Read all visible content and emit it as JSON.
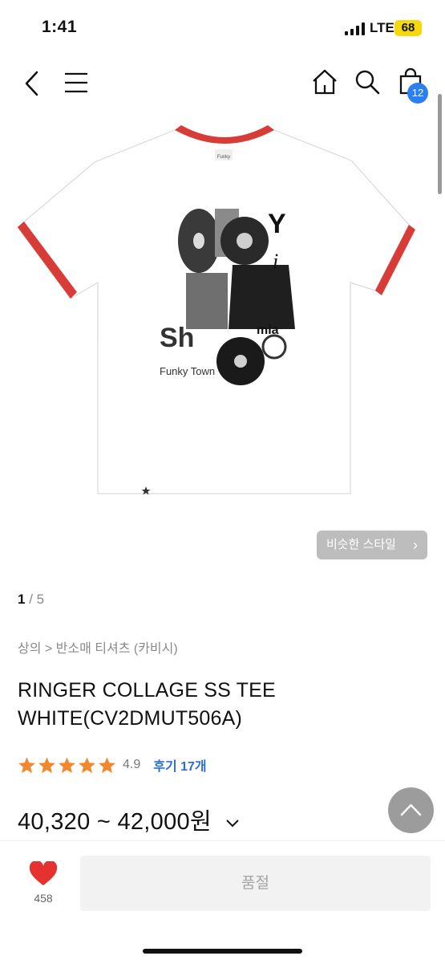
{
  "status": {
    "time": "1:41",
    "network": "LTE",
    "battery": "68"
  },
  "nav": {
    "cart_count": "12"
  },
  "similar_style": {
    "label": "비슷한 스타일"
  },
  "gallery": {
    "current": "1",
    "separator": "/",
    "total": "5"
  },
  "breadcrumb": "상의 > 반소매 티셔츠 (카비시)",
  "product": {
    "title_line1": "RINGER COLLAGE SS TEE",
    "title_line2": "WHITE(CV2DMUT506A)",
    "rating": 4.9,
    "rating_text": "4.9",
    "stars": 5,
    "reviews_label": "후기 17개",
    "price": "40,320 ~ 42,000원",
    "print_text_funky": "Funky Town",
    "print_text_sh": "Sh",
    "print_text_mia": "mia"
  },
  "bottom": {
    "like_count": "458",
    "soldout_label": "품절"
  },
  "colors": {
    "accent_blue": "#2b7ff0",
    "star": "#f0892e",
    "ringer_red": "#d83c37",
    "heart": "#e5312f"
  }
}
